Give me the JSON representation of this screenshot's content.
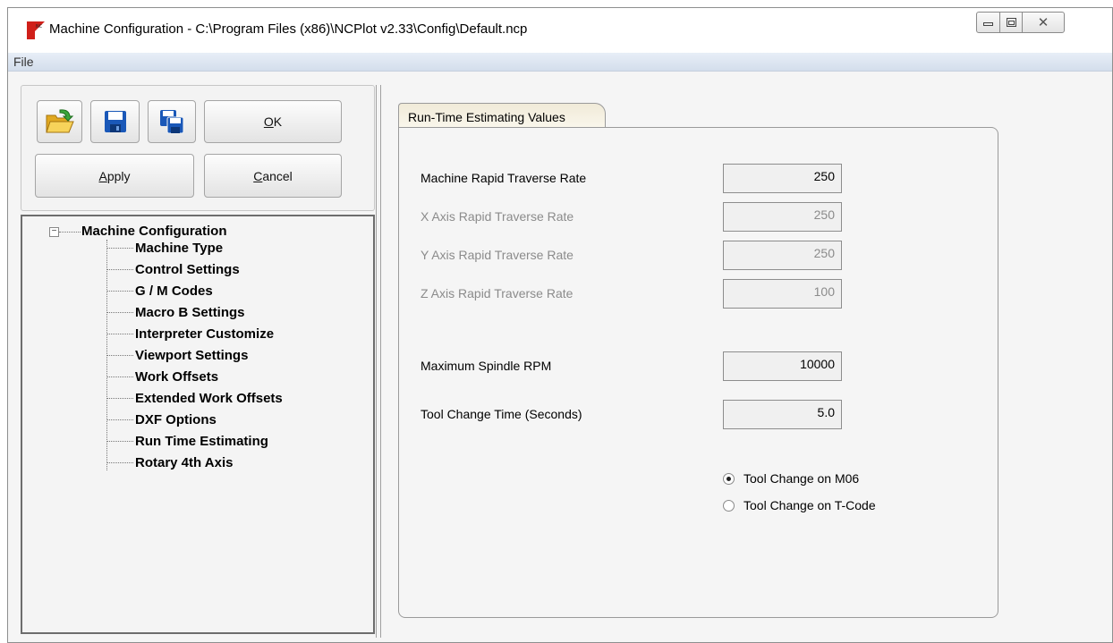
{
  "window": {
    "title": "Machine Configuration - C:\\Program Files (x86)\\NCPlot v2.33\\Config\\Default.ncp",
    "icon_text": "NC",
    "close_glyph": "✕"
  },
  "menu": {
    "file": "File"
  },
  "toolbar": {
    "ok_label": "OK",
    "apply_label": "Apply",
    "cancel_label": "Cancel"
  },
  "tree": {
    "root": "Machine Configuration",
    "items": [
      "Machine Type",
      "Control Settings",
      "G / M Codes",
      "Macro B Settings",
      "Interpreter Customize",
      "Viewport Settings",
      "Work Offsets",
      "Extended Work Offsets",
      "DXF Options",
      "Run Time Estimating",
      "Rotary 4th Axis"
    ]
  },
  "tab": {
    "label": "Run-Time Estimating Values"
  },
  "fields": [
    {
      "label": "Machine Rapid Traverse Rate",
      "value": "250",
      "enabled": true
    },
    {
      "label": "X Axis Rapid Traverse Rate",
      "value": "250",
      "enabled": false
    },
    {
      "label": "Y Axis Rapid Traverse Rate",
      "value": "250",
      "enabled": false
    },
    {
      "label": "Z Axis Rapid Traverse Rate",
      "value": "100",
      "enabled": false
    },
    {
      "label": "Maximum Spindle RPM",
      "value": "10000",
      "enabled": true
    },
    {
      "label": "Tool Change Time (Seconds)",
      "value": "5.0",
      "enabled": true
    }
  ],
  "radios": [
    {
      "label": "Tool Change on M06",
      "selected": true
    },
    {
      "label": "Tool Change on T-Code",
      "selected": false
    }
  ],
  "colors": {
    "accent_red": "#d0201a",
    "disabled_text": "#8b8b8b",
    "save_blue": "#1a58b8"
  }
}
